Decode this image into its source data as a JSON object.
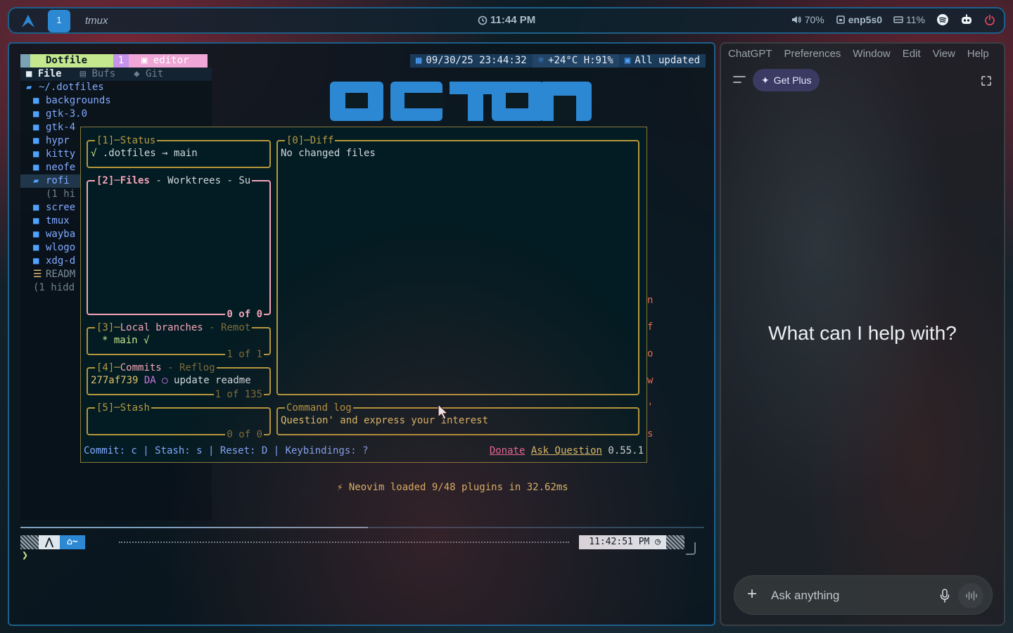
{
  "topbar": {
    "workspace": "1",
    "app_title": "tmux",
    "clock": "11:44 PM",
    "volume": "70%",
    "network": "enp5s0",
    "disk": "11%"
  },
  "nvim": {
    "status": {
      "project": "Dotfile",
      "window_num": "1",
      "window_name": "editor",
      "datetime": "09/30/25 23:44:32",
      "weather": "+24°C H:91%",
      "updates": "All updated"
    },
    "sidebar": {
      "tabs": [
        "File",
        "Bufs",
        "Git"
      ],
      "root": "~/.dotfiles",
      "items": [
        {
          "label": "backgrounds",
          "type": "folder"
        },
        {
          "label": "gtk-3.0",
          "type": "folder"
        },
        {
          "label": "gtk-4",
          "type": "folder"
        },
        {
          "label": "hypr",
          "type": "folder"
        },
        {
          "label": "kitty",
          "type": "folder"
        },
        {
          "label": "neofe",
          "type": "folder"
        },
        {
          "label": "rofi",
          "type": "folder-open"
        },
        {
          "label": "(1 hi",
          "type": "hidden"
        },
        {
          "label": "scree",
          "type": "folder"
        },
        {
          "label": "tmux",
          "type": "folder"
        },
        {
          "label": "wayba",
          "type": "folder"
        },
        {
          "label": "wlogo",
          "type": "folder"
        },
        {
          "label": "xdg-d",
          "type": "folder"
        },
        {
          "label": "READM",
          "type": "file"
        },
        {
          "label": "(1 hidd",
          "type": "hidden"
        }
      ]
    },
    "startup_message": "Neovim loaded 9/48 plugins in 32.62ms",
    "side_letters": [
      "n",
      "f",
      "o",
      "w",
      "'",
      "s"
    ]
  },
  "lazygit": {
    "status": {
      "title_num": "[1]",
      "title": "Status",
      "check": "√",
      "text": ".dotfiles → main"
    },
    "files": {
      "title_num": "[2]",
      "title": "Files",
      "tabs_rest": " - Worktrees - Su",
      "count": "0 of 0"
    },
    "branches": {
      "title_num": "[3]",
      "title": "Local branches",
      "tabs_rest": " - Remot",
      "item": "* main √",
      "count": "1 of 1"
    },
    "commits": {
      "title_num": "[4]",
      "title": "Commits",
      "tabs_rest": " - Reflog",
      "hash": "277af739",
      "author": "DA",
      "marker": "○",
      "message": "update readme",
      "count": "1 of 135"
    },
    "stash": {
      "title_num": "[5]",
      "title": "Stash",
      "count": "0 of 0"
    },
    "diff": {
      "title_num": "[0]",
      "title": "Diff",
      "text": "No changed files"
    },
    "command_log": {
      "title": "Command log",
      "text": "Question' and express your interest"
    },
    "footer": {
      "keys": "Commit: c | Stash: s | Reset: D | Keybindings: ?",
      "donate": "Donate",
      "ask": "Ask Question",
      "version": "0.55.1"
    }
  },
  "tmux": {
    "home": "~",
    "time": "11:42:51 PM",
    "prompt": "❯"
  },
  "chatgpt": {
    "menu": [
      "ChatGPT",
      "Preferences",
      "Window",
      "Edit",
      "View",
      "Help"
    ],
    "get_plus": "Get Plus",
    "hero": "What can I help with?",
    "input_placeholder": "Ask anything"
  },
  "colors": {
    "accent_blue": "#2d88d4",
    "border_blue": "#1d5f8a",
    "lazygit_border": "#b5983b",
    "active_pink": "#f4a6b8",
    "green": "#c3e88d",
    "getplus_bg": "#3b3a62"
  },
  "icons": [
    "arch-logo-icon",
    "clock-icon",
    "volume-icon",
    "network-icon",
    "disk-icon",
    "spotify-icon",
    "bot-icon",
    "power-icon",
    "calendar-icon",
    "sun-icon",
    "package-icon",
    "folder-icon",
    "file-icon",
    "git-icon",
    "home-icon",
    "sidebar-toggle-icon",
    "sparkle-icon",
    "expand-icon",
    "plus-icon",
    "mic-icon",
    "voice-wave-icon",
    "mouse-cursor-icon"
  ]
}
